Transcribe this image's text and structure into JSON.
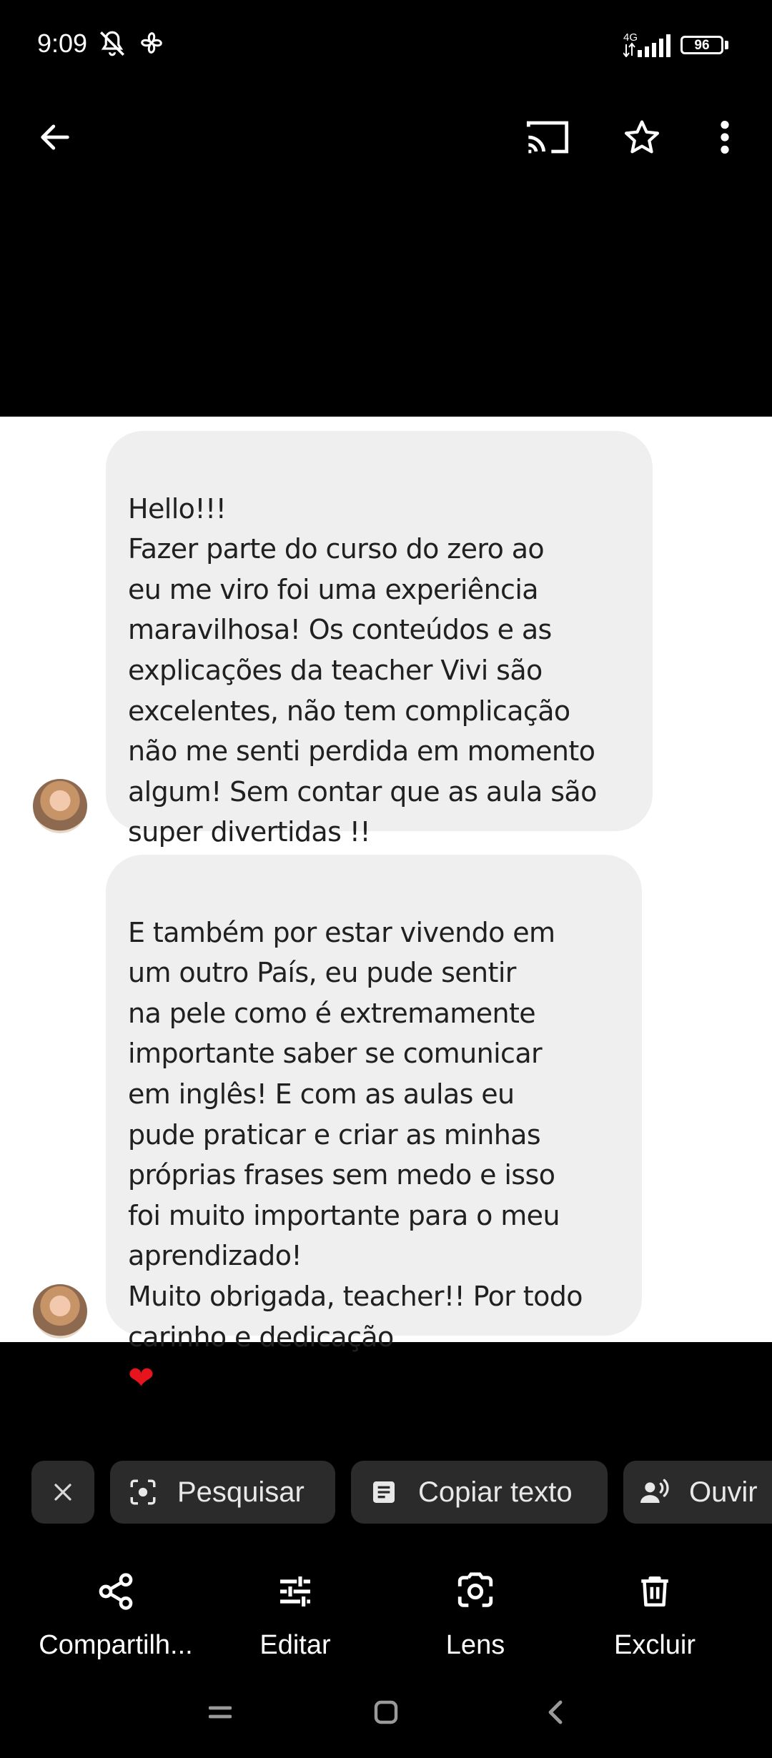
{
  "status_bar": {
    "time": "9:09",
    "network": "4G",
    "battery": "96",
    "icons": [
      "mute-bell-icon",
      "fan-icon",
      "signal-icon",
      "battery-icon"
    ]
  },
  "app_bar": {
    "icons": [
      "back-arrow-icon",
      "cast-icon",
      "star-icon",
      "more-vert-icon"
    ]
  },
  "photo": {
    "message1": "Hello!!!\nFazer parte do curso do zero ao\neu me viro foi uma experiência\nmaravilhosa! Os conteúdos e as\nexplicações da teacher Vivi são\nexcelentes, não tem complicação\nnão me senti perdida em momento\nalgum! Sem contar que as aula são\nsuper divertidas !!",
    "message2": "E também por estar vivendo em\num outro País, eu pude sentir\nna pele como é extremamente\nimportante saber se comunicar\nem inglês! E com as aulas eu\npude praticar e criar as minhas\npróprias frases sem medo e isso\nfoi muito importante para o meu\naprendizado!\nMuito obrigada, teacher!! Por todo\ncarinho e dedicação",
    "heart": "❤"
  },
  "chips": {
    "search": "Pesquisar",
    "copy": "Copiar texto",
    "listen": "Ouvir"
  },
  "actions": {
    "share": "Compartilh...",
    "edit": "Editar",
    "lens": "Lens",
    "delete": "Excluir"
  },
  "colors": {
    "background": "#000000",
    "chip_bg": "#2b2b2b",
    "bubble_bg": "#efefef",
    "heart": "#e8141d"
  }
}
